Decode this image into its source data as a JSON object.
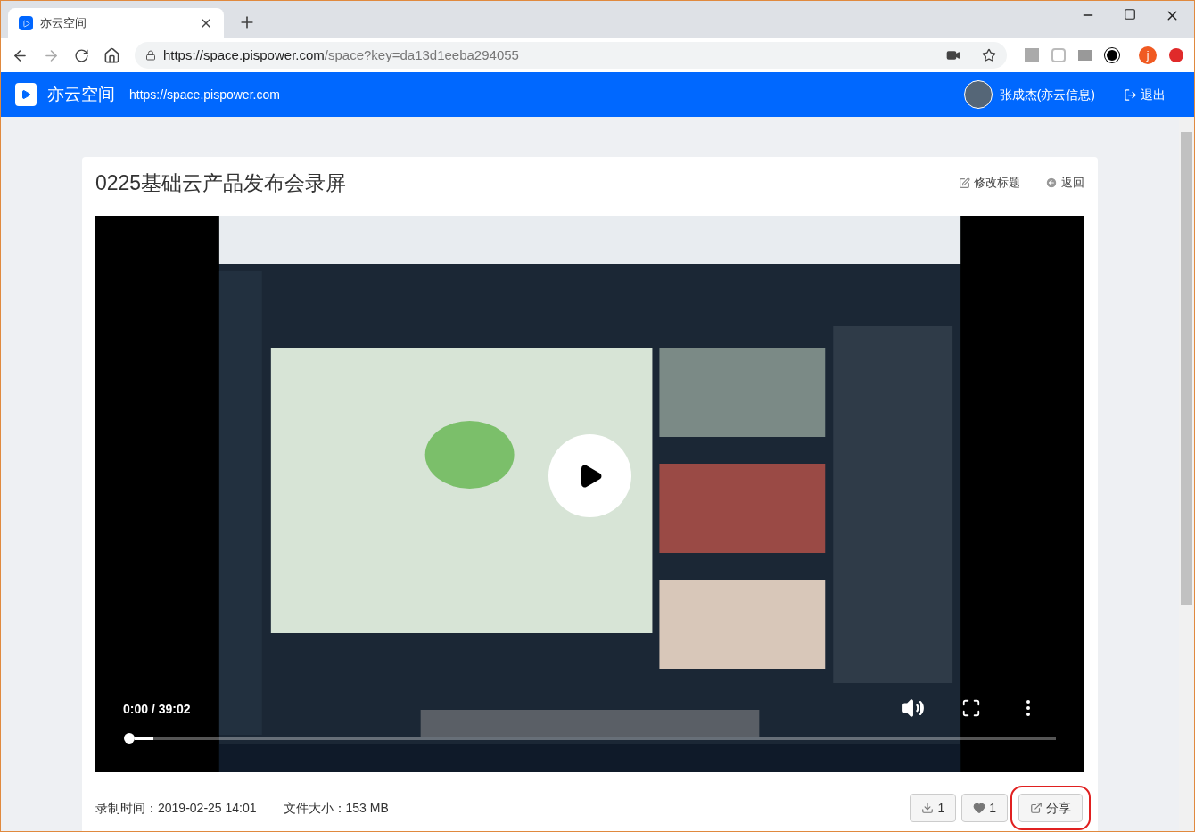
{
  "browser": {
    "tab": {
      "title": "亦云空间",
      "selected": true
    },
    "address": {
      "host": "https://space.pispower.com",
      "path": "/space?key=da13d1eeba294055"
    },
    "profile_initial": "j"
  },
  "header": {
    "brand": "亦云空间",
    "site_url": "https://space.pispower.com",
    "user": "张成杰(亦云信息)",
    "logout": "退出"
  },
  "recording": {
    "title": "0225基础云产品发布会录屏",
    "edit_title": "修改标题",
    "back": "返回",
    "player": {
      "time": "0:00 / 39:02",
      "level": 0.02
    },
    "recorded_label": "录制时间：",
    "recorded_at": "2019-02-25 14:01",
    "size_label": "文件大小：",
    "size": "153 MB",
    "downloads": "1",
    "likes": "1",
    "share": "分享"
  }
}
